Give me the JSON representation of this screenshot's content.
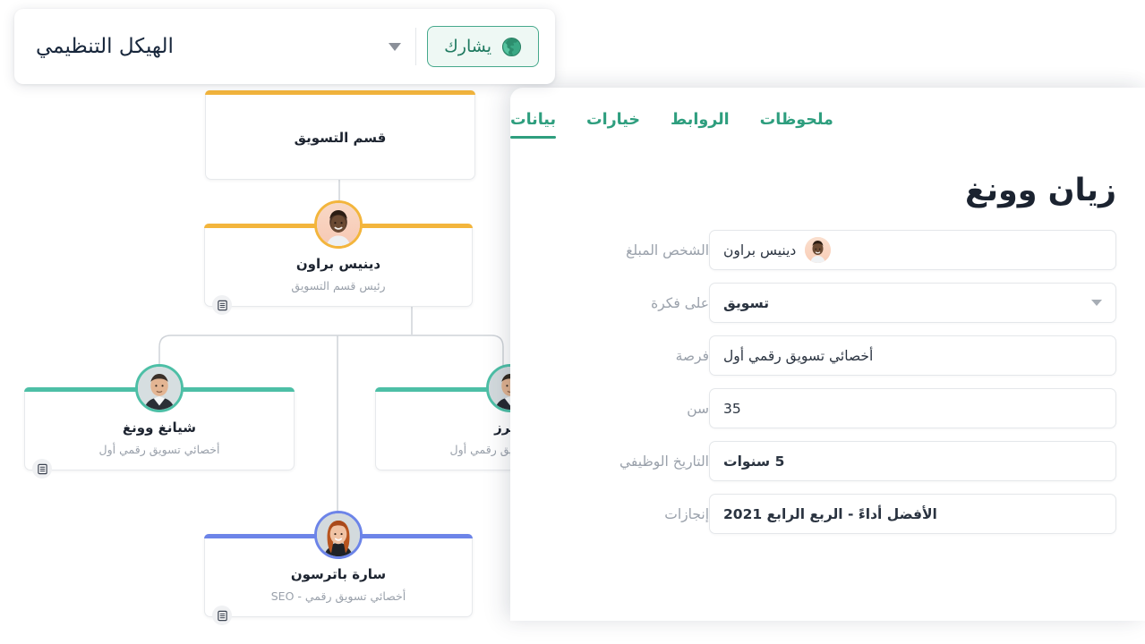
{
  "toolbar": {
    "chart_name": "الهيكل التنظيمي",
    "share_label": "يشارك",
    "globe_icon": "globe-icon",
    "caret_icon": "chevron-down-icon"
  },
  "org_chart": {
    "nodes": [
      {
        "id": "dept",
        "title": "قسم التسويق",
        "subtitle": "",
        "accent": "#F3B53C",
        "has_avatar": false,
        "has_badge": false
      },
      {
        "id": "head",
        "title": "دينيس براون",
        "subtitle": "رئيس قسم التسويق",
        "accent": "#F3B53C",
        "has_avatar": true,
        "avatar_ring": "#F3B53C",
        "has_badge": true
      },
      {
        "id": "left",
        "title": "شيانغ وونغ",
        "subtitle": "أخصائي تسويق رقمي أول",
        "accent": "#4DBFA6",
        "has_avatar": true,
        "avatar_ring": "#4DBFA6",
        "has_badge": true
      },
      {
        "id": "mid",
        "title": "بيترز",
        "subtitle": "أخصائي تسويق رقمي أول",
        "accent": "#4DBFA6",
        "has_avatar": true,
        "avatar_ring": "#4DBFA6",
        "has_badge": false
      },
      {
        "id": "bottom",
        "title": "سارة باترسون",
        "subtitle": "أخصائي تسويق رقمي - SEO",
        "accent": "#6C84E8",
        "has_avatar": true,
        "avatar_ring": "#6C84E8",
        "has_badge": true
      }
    ],
    "badge_icon": "list-card-icon"
  },
  "panel": {
    "tabs": [
      {
        "label": "بيانات",
        "active": true
      },
      {
        "label": "خيارات",
        "active": false
      },
      {
        "label": "الروابط",
        "active": false
      },
      {
        "label": "ملحوظات",
        "active": false
      }
    ],
    "accent_color": "#2E9E7E",
    "person_name": "زيان وونغ",
    "fields": [
      {
        "label": "الشخص المبلغ",
        "value": "دينيس براون",
        "type": "person",
        "bold": false,
        "avatar": "dennis-brown-avatar"
      },
      {
        "label": "على فكرة",
        "value": "تسويق",
        "type": "select",
        "bold": true
      },
      {
        "label": "فرصة",
        "value": "أخصائي تسويق رقمي أول",
        "type": "text",
        "bold": false
      },
      {
        "label": "سن",
        "value": "35",
        "type": "text",
        "bold": false
      },
      {
        "label": "التاريخ الوظيفي",
        "value": "5 سنوات",
        "type": "text",
        "bold": true
      },
      {
        "label": "إنجازات",
        "value": "الأفضل أداءً - الربع الرابع 2021",
        "type": "text",
        "bold": true
      }
    ]
  }
}
